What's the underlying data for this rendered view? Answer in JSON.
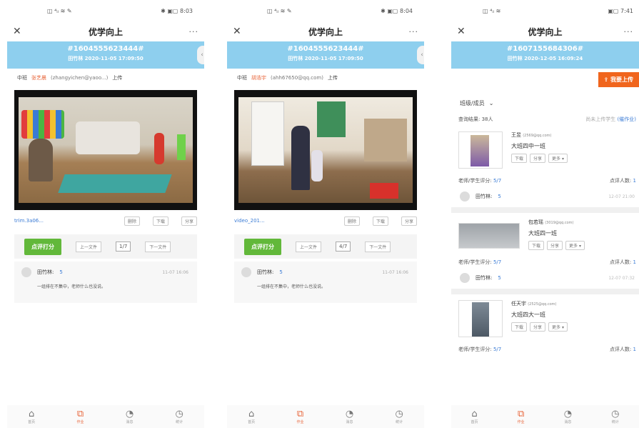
{
  "status": {
    "p1": {
      "left": "◫ ⁴ᵢₗ ≋ ✎",
      "right": "✱ ▣▢ 8:03"
    },
    "p2": {
      "left": "◫ ⁴ᵢₗ ≋ ✎",
      "right": "✱ ▣▢ 8:04"
    },
    "p3": {
      "left": "◫ ⁴ᵢₗ ≋",
      "right": "▣▢ 7:41"
    }
  },
  "header": {
    "title": "优学向上",
    "close": "✕",
    "more": "···"
  },
  "screen1": {
    "code": "#1604555623444#",
    "sub": "田竹林   2020-11-05 17:09:50",
    "uploader_label": "中班",
    "uploader_name": "张艺晨",
    "uploader_mail": "(zhangyichen@yaoo...)",
    "upload_word": "上传",
    "file_name": "trim.3a06...",
    "btn_delete": "删除",
    "btn_download": "下载",
    "btn_share": "分享",
    "score_btn": "点评打分",
    "prev": "上一文件",
    "page": "1/7",
    "next": "下一文件",
    "commenter": "田竹林:",
    "score": "5",
    "time": "11-07 16:06",
    "comment": "一组排在不集中，老师什么也没说。"
  },
  "screen2": {
    "code": "#1604555623444#",
    "sub": "田竹林   2020-11-05 17:09:50",
    "uploader_label": "中班",
    "uploader_name": "胡浩宇",
    "uploader_mail": "(ahh67650@qq.com)",
    "upload_word": "上传",
    "file_name": "video_201...",
    "btn_delete": "删除",
    "btn_download": "下载",
    "btn_share": "分享",
    "score_btn": "点评打分",
    "prev": "上一文件",
    "page": "4/7",
    "next": "下一文件",
    "commenter": "田竹林:",
    "score": "5",
    "time": "11-07 16:06",
    "comment": "一组排在不集中，老师什么也没说。"
  },
  "screen3": {
    "code": "#1607155684306#",
    "sub": "田竹林   2020-12-05 16:09:24",
    "upload_btn": "我要上传",
    "filter": "班级/成员",
    "query_result": "查询结果: 38人",
    "query_right": "尚未上传学生",
    "query_link": "(催作业)",
    "students": [
      {
        "name": "王昱",
        "mail": "(2569@qq.com)",
        "cls": "大班四中一班",
        "ops": [
          "下载",
          "分享",
          "更多 ▾"
        ],
        "eval_label": "老师/学生评分:",
        "eval_num": "5/7",
        "count_label": "点评人数:",
        "count": "1",
        "teacher": "田竹林:",
        "score": "5",
        "time": "12-07 21:00"
      },
      {
        "name": "包若瑶",
        "mail": "(3019@qq.com)",
        "cls": "大班四一班",
        "ops": [
          "下载",
          "分享",
          "更多 ▾"
        ],
        "eval_label": "老师/学生评分:",
        "eval_num": "5/7",
        "count_label": "点评人数:",
        "count": "1",
        "teacher": "田竹林:",
        "score": "5",
        "time": "12-07 07:32"
      },
      {
        "name": "任天宇",
        "mail": "(2525@qq.com)",
        "cls": "大班四大一班",
        "ops": [
          "下载",
          "分享",
          "更多 ▾"
        ],
        "eval_label": "老师/学生评分:",
        "eval_num": "5/7",
        "count_label": "点评人数:",
        "count": "1"
      }
    ]
  },
  "tabs": [
    {
      "icon": "⌂",
      "label": "首页"
    },
    {
      "icon": "⧉",
      "label": "作业"
    },
    {
      "icon": "◔",
      "label": "消息"
    },
    {
      "icon": "◷",
      "label": "统计"
    }
  ],
  "colors": {
    "banner": "#8ecfee",
    "accent": "#e8663b",
    "green": "#62b83a",
    "link": "#3a7bd5",
    "orange": "#f0651d"
  }
}
